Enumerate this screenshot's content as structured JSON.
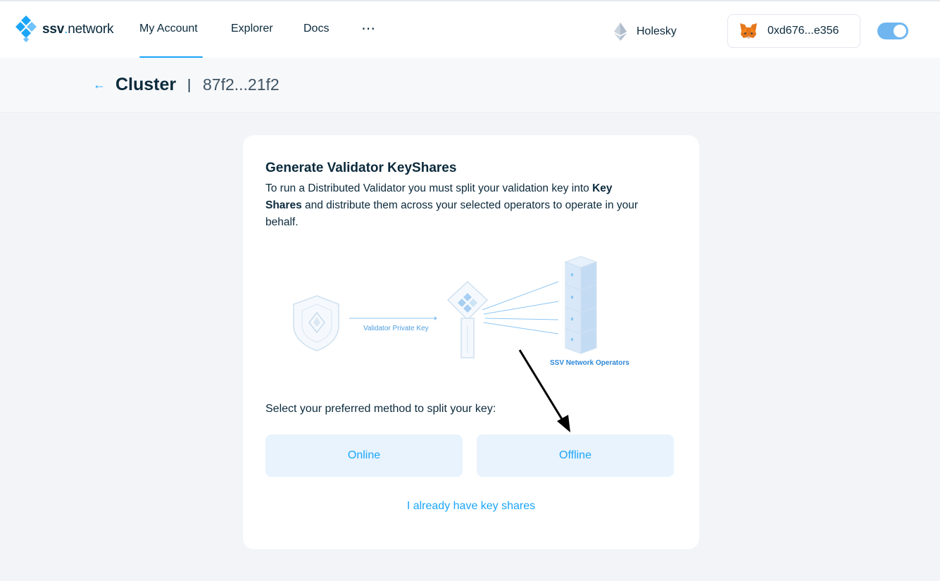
{
  "header": {
    "logo_bold": "ssv",
    "logo_dot": ".",
    "logo_rest": "network",
    "nav": [
      {
        "label": "My Account",
        "active": true
      },
      {
        "label": "Explorer"
      },
      {
        "label": "Docs"
      }
    ],
    "more_label": "⋯",
    "network_label": "Holesky",
    "wallet_address": "0xd676...e356",
    "theme_toggle_on": true
  },
  "subheader": {
    "back_icon": "arrow-left-icon",
    "title": "Cluster",
    "separator": "|",
    "cluster_id": "87f2...21f2"
  },
  "card": {
    "title": "Generate Validator KeyShares",
    "description_part1": "To run a Distributed Validator you must split your validation key into ",
    "description_bold": "Key Shares",
    "description_part2": " and distribute them across your selected operators to operate in your behalf.",
    "diagram": {
      "key_label": "Validator Private Key",
      "operators_label": "SSV Network Operators"
    },
    "method_prompt": "Select your preferred method to split your key:",
    "buttons": {
      "online": "Online",
      "offline": "Offline"
    },
    "existing_link": "I already have key shares"
  },
  "colors": {
    "accent": "#1ba5f8",
    "text": "#0b2a3c",
    "button_bg": "#e8f3fd",
    "page_bg": "#f2f4f7"
  }
}
